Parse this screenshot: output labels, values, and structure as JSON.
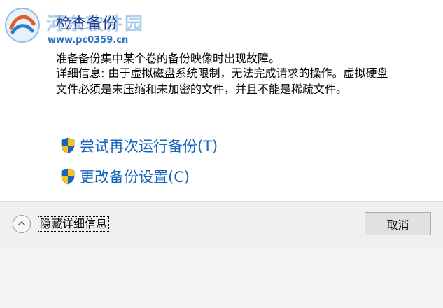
{
  "watermark": {
    "site_name": "河东软件园",
    "url": "www.pc0359.cn"
  },
  "dialog": {
    "title": "检查备份",
    "main_message": "准备备份集中某个卷的备份映像时出现故障。",
    "detail_lines": [
      "详细信息: 由于虚拟磁盘系统限制，无法完成请求的操作。虚拟硬盘",
      "文件必须是未压缩和未加密的文件，并且不能是稀疏文件。"
    ],
    "links": {
      "retry": "尝试再次运行备份(T)",
      "settings": "更改备份设置(C)"
    }
  },
  "footer": {
    "hide_details": "隐藏详细信息",
    "cancel": "取消"
  },
  "colors": {
    "title": "#1a3a8a",
    "link": "#1565c0",
    "footer_bg": "#f0f0f0"
  }
}
